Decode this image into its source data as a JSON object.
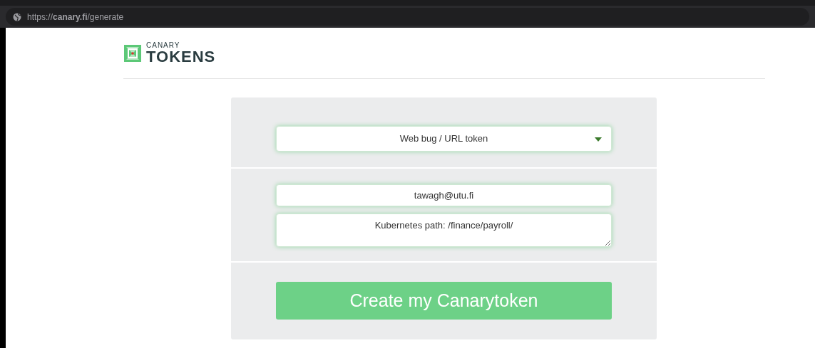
{
  "browser": {
    "url": "https://**canary.fi**/generate"
  },
  "logo": {
    "top_word": "CANARY",
    "main_word": "TOKENS"
  },
  "form": {
    "token_type": "Web bug / URL token",
    "email": "tawagh@utu.fi",
    "memo": "Kubernetes path: /finance/payroll/",
    "submit": "Create my Canarytoken"
  }
}
